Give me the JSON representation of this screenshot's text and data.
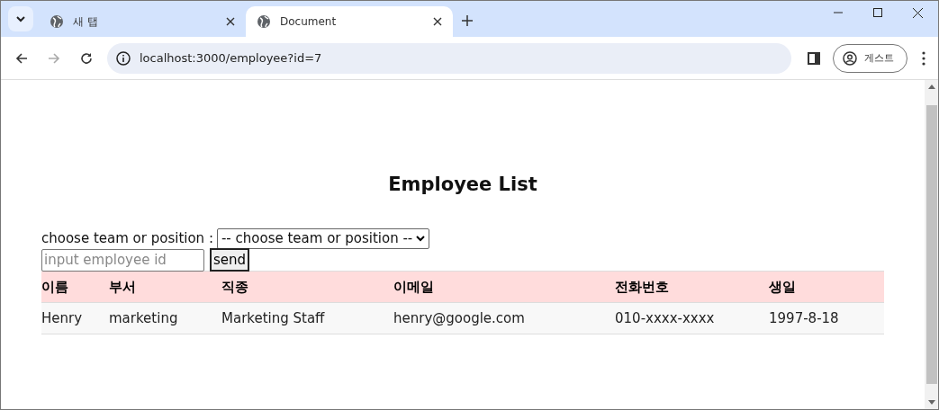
{
  "tabs": [
    {
      "label": "새 탭",
      "selected": false
    },
    {
      "label": "Document",
      "selected": true
    }
  ],
  "address_bar": {
    "url": "localhost:3000/employee?id=7"
  },
  "profile_button": {
    "label": "게스트"
  },
  "page": {
    "title": "Employee List",
    "filter_label": "choose team or position :",
    "filter_select": {
      "value": "-- choose team or position --"
    },
    "id_field": {
      "placeholder": "input employee id"
    },
    "send_button": "send",
    "table": {
      "columns": [
        "이름",
        "부서",
        "직종",
        "이메일",
        "전화번호",
        "생일"
      ],
      "rows": [
        [
          "Henry",
          "marketing",
          "Marketing Staff",
          "henry@google.com",
          "010-xxxx-xxxx",
          "1997-8-18"
        ]
      ]
    }
  }
}
